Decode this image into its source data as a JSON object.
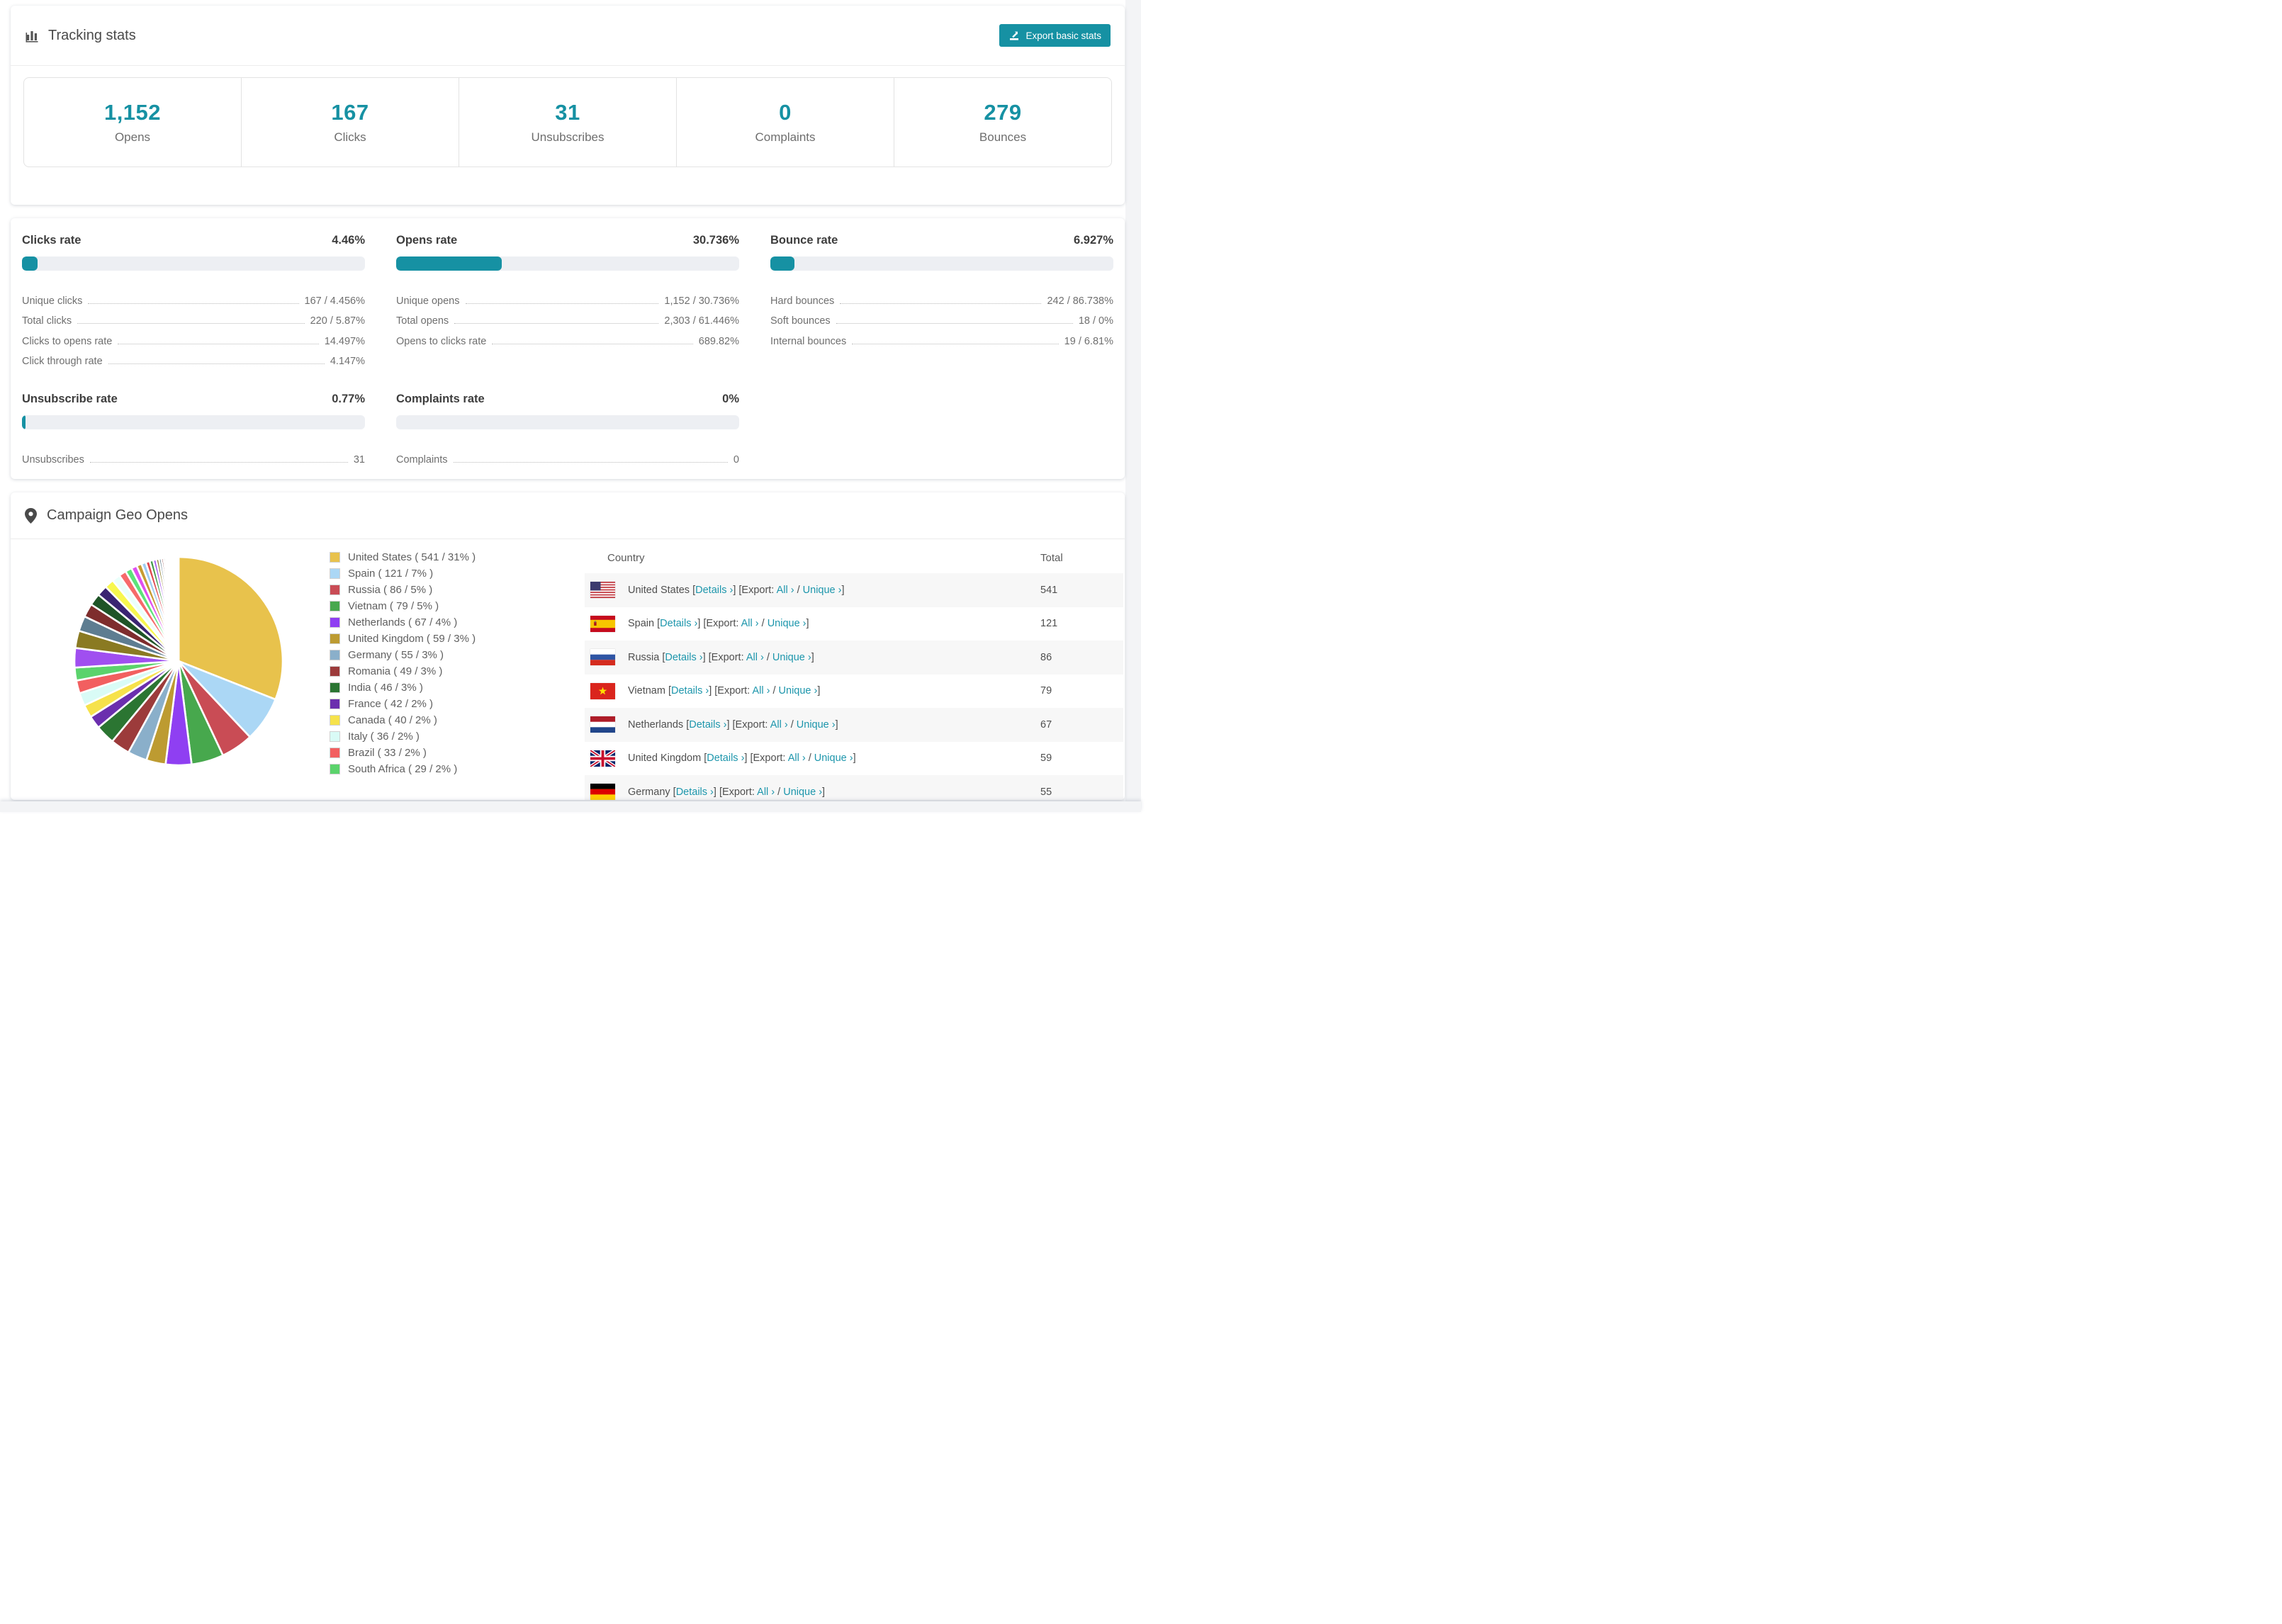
{
  "accent_color": "#1691a3",
  "link_color": "#1d96ac",
  "tracking": {
    "title": "Tracking stats",
    "export_button": "Export basic stats",
    "summary_stats": [
      {
        "value": "1,152",
        "label": "Opens"
      },
      {
        "value": "167",
        "label": "Clicks"
      },
      {
        "value": "31",
        "label": "Unsubscribes"
      },
      {
        "value": "0",
        "label": "Complaints"
      },
      {
        "value": "279",
        "label": "Bounces"
      }
    ]
  },
  "rates": {
    "blocks": [
      {
        "title": "Clicks rate",
        "value": "4.46%",
        "bar_pct": 4.46,
        "rows": [
          {
            "label": "Unique clicks",
            "value": "167 / 4.456%"
          },
          {
            "label": "Total clicks",
            "value": "220 / 5.87%"
          },
          {
            "label": "Clicks to opens rate",
            "value": "14.497%"
          },
          {
            "label": "Click through rate",
            "value": "4.147%"
          }
        ]
      },
      {
        "title": "Opens rate",
        "value": "30.736%",
        "bar_pct": 30.736,
        "rows": [
          {
            "label": "Unique opens",
            "value": "1,152 / 30.736%"
          },
          {
            "label": "Total opens",
            "value": "2,303 / 61.446%"
          },
          {
            "label": "Opens to clicks rate",
            "value": "689.82%"
          }
        ]
      },
      {
        "title": "Bounce rate",
        "value": "6.927%",
        "bar_pct": 6.927,
        "rows": [
          {
            "label": "Hard bounces",
            "value": "242 / 86.738%"
          },
          {
            "label": "Soft bounces",
            "value": "18 / 0%"
          },
          {
            "label": "Internal bounces",
            "value": "19 / 6.81%"
          }
        ]
      },
      {
        "title": "Unsubscribe rate",
        "value": "0.77%",
        "bar_pct": 0.77,
        "rows": [
          {
            "label": "Unsubscribes",
            "value": "31"
          }
        ]
      },
      {
        "title": "Complaints rate",
        "value": "0%",
        "bar_pct": 0,
        "rows": [
          {
            "label": "Complaints",
            "value": "0"
          }
        ]
      }
    ]
  },
  "geo": {
    "title": "Campaign Geo Opens",
    "table": {
      "col_country": "Country",
      "col_total": "Total",
      "details_label": "Details ›",
      "export_prefix": "[Export:",
      "all_label": "All ›",
      "slash": "/",
      "unique_label": "Unique ›",
      "rows": [
        {
          "country": "United States",
          "flag": "us",
          "total": "541"
        },
        {
          "country": "Spain",
          "flag": "es",
          "total": "121"
        },
        {
          "country": "Russia",
          "flag": "ru",
          "total": "86"
        },
        {
          "country": "Vietnam",
          "flag": "vn",
          "total": "79"
        },
        {
          "country": "Netherlands",
          "flag": "nl",
          "total": "67"
        },
        {
          "country": "United Kingdom",
          "flag": "gb",
          "total": "59"
        },
        {
          "country": "Germany",
          "flag": "de",
          "total": "55"
        }
      ]
    }
  },
  "chart_data": {
    "type": "pie",
    "title": "Campaign Geo Opens",
    "legend_position": "right",
    "slices": [
      {
        "label": "United States",
        "value": 541,
        "pct": 31,
        "color": "#e8c24c"
      },
      {
        "label": "Spain",
        "value": 121,
        "pct": 7,
        "color": "#abd7f5"
      },
      {
        "label": "Russia",
        "value": 86,
        "pct": 5,
        "color": "#c94c55"
      },
      {
        "label": "Vietnam",
        "value": 79,
        "pct": 5,
        "color": "#47a84d"
      },
      {
        "label": "Netherlands",
        "value": 67,
        "pct": 4,
        "color": "#8f3ff2"
      },
      {
        "label": "United Kingdom",
        "value": 59,
        "pct": 3,
        "color": "#bd9b31"
      },
      {
        "label": "Germany",
        "value": 55,
        "pct": 3,
        "color": "#8aafca"
      },
      {
        "label": "Romania",
        "value": 49,
        "pct": 3,
        "color": "#9c3b3b"
      },
      {
        "label": "India",
        "value": 46,
        "pct": 3,
        "color": "#2b7532"
      },
      {
        "label": "France",
        "value": 42,
        "pct": 2,
        "color": "#6b2fae"
      },
      {
        "label": "Canada",
        "value": 40,
        "pct": 2,
        "color": "#f6e24b"
      },
      {
        "label": "Italy",
        "value": 36,
        "pct": 2,
        "color": "#d9fbf6"
      },
      {
        "label": "Brazil",
        "value": 33,
        "pct": 2,
        "color": "#f25f60"
      },
      {
        "label": "South Africa",
        "value": 29,
        "pct": 2,
        "color": "#5bd36c"
      }
    ],
    "legend_format": "{label} ( {value} / {pct}% )",
    "tail": {
      "note": "long tail of many tiny unlabeled country slices",
      "total_pct": 26,
      "count": 38,
      "start": 1.65,
      "decay": 0.885,
      "palette": [
        "#a04ff0",
        "#8a7a22",
        "#5e7d91",
        "#7e2d2d",
        "#1e5427",
        "#3a2472",
        "#f7f74e",
        "#eafffb",
        "#f66a6a",
        "#5de37a",
        "#e04ff0",
        "#c79b31",
        "#9fcdf2",
        "#e0474f",
        "#3f9a46"
      ]
    }
  }
}
